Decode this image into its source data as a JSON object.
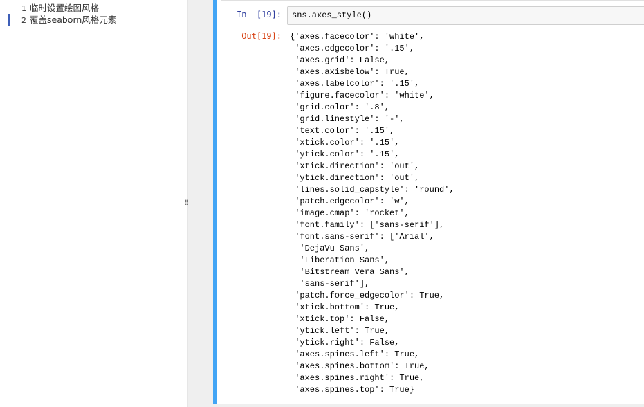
{
  "toc": {
    "items": [
      {
        "num": "1",
        "label": "临时设置绘图风格",
        "active": false
      },
      {
        "num": "2",
        "label": "覆盖seaborn风格元素",
        "active": true
      }
    ]
  },
  "splitter": {
    "grip": "⁞⁞"
  },
  "cell": {
    "in_prompt": "In  [19]:",
    "input_code": "sns.axes_style()",
    "out_prompt": "Out[19]:",
    "output_lines": [
      "{'axes.facecolor': 'white',",
      " 'axes.edgecolor': '.15',",
      " 'axes.grid': False,",
      " 'axes.axisbelow': True,",
      " 'axes.labelcolor': '.15',",
      " 'figure.facecolor': 'white',",
      " 'grid.color': '.8',",
      " 'grid.linestyle': '-',",
      " 'text.color': '.15',",
      " 'xtick.color': '.15',",
      " 'ytick.color': '.15',",
      " 'xtick.direction': 'out',",
      " 'ytick.direction': 'out',",
      " 'lines.solid_capstyle': 'round',",
      " 'patch.edgecolor': 'w',",
      " 'image.cmap': 'rocket',",
      " 'font.family': ['sans-serif'],",
      " 'font.sans-serif': ['Arial',",
      "  'DejaVu Sans',",
      "  'Liberation Sans',",
      "  'Bitstream Vera Sans',",
      "  'sans-serif'],",
      " 'patch.force_edgecolor': True,",
      " 'xtick.bottom': True,",
      " 'xtick.top': False,",
      " 'ytick.left': True,",
      " 'ytick.right': False,",
      " 'axes.spines.left': True,",
      " 'axes.spines.bottom': True,",
      " 'axes.spines.right': True,",
      " 'axes.spines.top': True}"
    ]
  },
  "colors": {
    "selected_cell_border": "#42a5f5",
    "toc_active_marker": "#3e5fb8",
    "in_prompt": "#303f9f",
    "out_prompt": "#d84315"
  }
}
